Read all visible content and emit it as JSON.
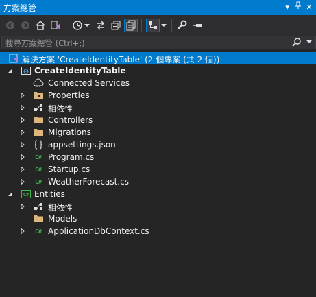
{
  "panel": {
    "title": "方案總管"
  },
  "search": {
    "placeholder": "搜尋方案總管 (Ctrl+;)"
  },
  "solution": {
    "label": "解決方案 'CreateIdentityTable' (2 個專案 (共 2 個))"
  },
  "projects": [
    {
      "label": "CreateIdentityTable",
      "items": [
        {
          "label": "Connected Services"
        },
        {
          "label": "Properties"
        },
        {
          "label": "相依性"
        },
        {
          "label": "Controllers"
        },
        {
          "label": "Migrations"
        },
        {
          "label": "appsettings.json"
        },
        {
          "label": "Program.cs"
        },
        {
          "label": "Startup.cs"
        },
        {
          "label": "WeatherForecast.cs"
        }
      ]
    },
    {
      "label": "Entities",
      "items": [
        {
          "label": "相依性"
        },
        {
          "label": "Models"
        },
        {
          "label": "ApplicationDbContext.cs"
        }
      ]
    }
  ],
  "colors": {
    "accent": "#007acc",
    "background": "#252526",
    "folder": "#dcb67a",
    "csharp": "#3fb950"
  }
}
